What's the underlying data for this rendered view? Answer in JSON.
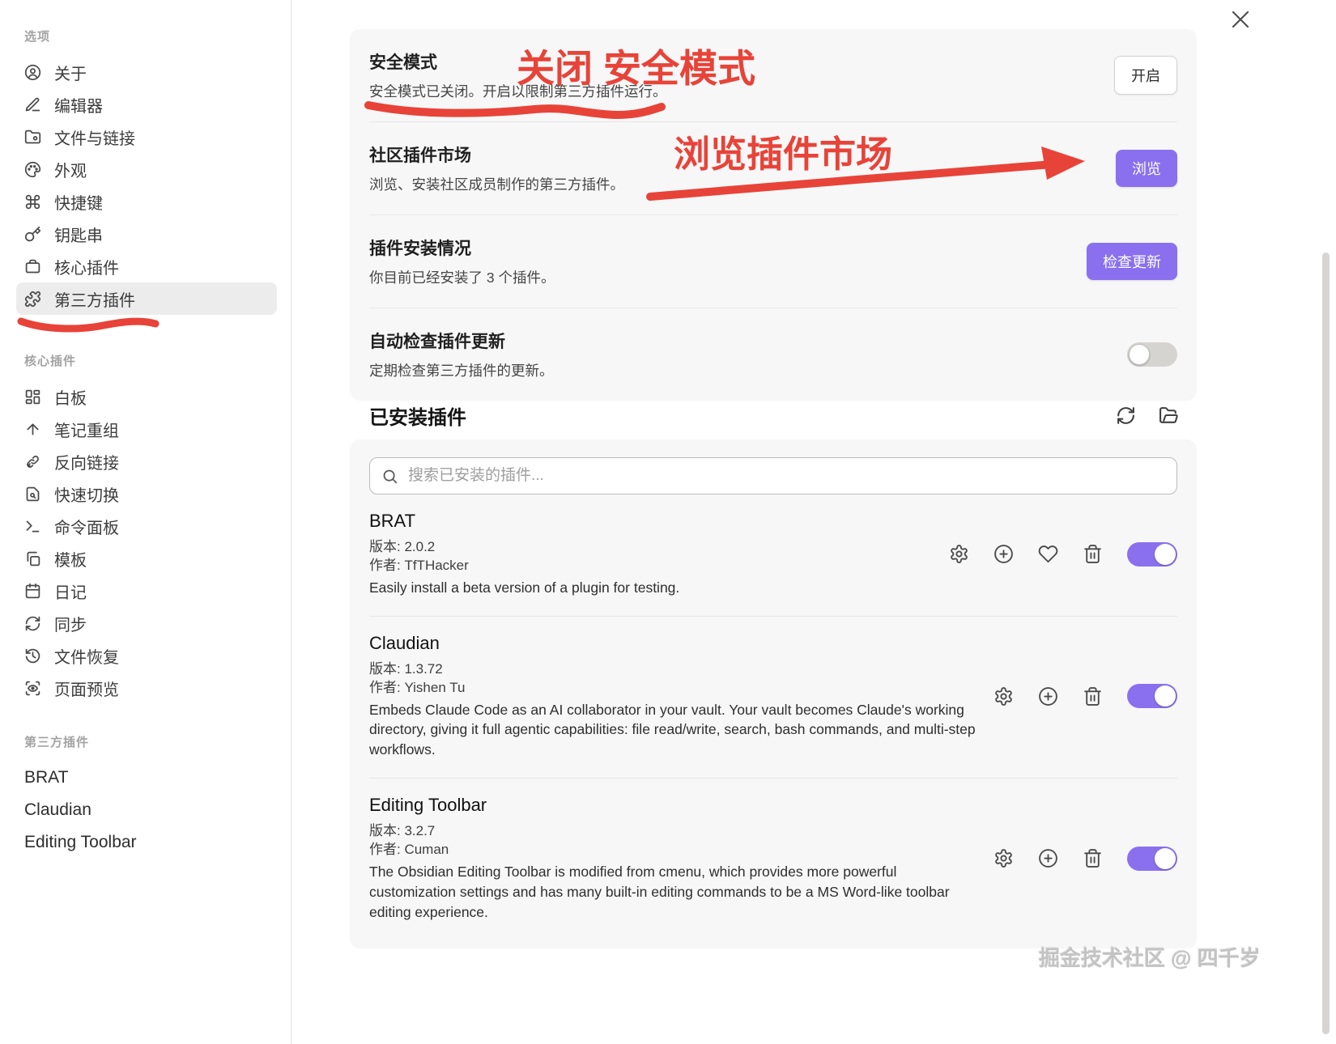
{
  "window": {
    "close_icon": "close"
  },
  "sidebar": {
    "sections": [
      {
        "header": "选项",
        "items": [
          {
            "icon": "user-circle-icon",
            "label": "关于"
          },
          {
            "icon": "pencil-icon",
            "label": "编辑器"
          },
          {
            "icon": "folder-link-icon",
            "label": "文件与链接"
          },
          {
            "icon": "palette-icon",
            "label": "外观"
          },
          {
            "icon": "command-icon",
            "label": "快捷键"
          },
          {
            "icon": "key-icon",
            "label": "钥匙串"
          },
          {
            "icon": "box-icon",
            "label": "核心插件"
          },
          {
            "icon": "puzzle-icon",
            "label": "第三方插件",
            "active": true
          }
        ]
      },
      {
        "header": "核心插件",
        "items": [
          {
            "icon": "dashboard-icon",
            "label": "白板"
          },
          {
            "icon": "arrow-up-icon",
            "label": "笔记重组"
          },
          {
            "icon": "backlink-icon",
            "label": "反向链接"
          },
          {
            "icon": "file-search-icon",
            "label": "快速切换"
          },
          {
            "icon": "terminal-icon",
            "label": "命令面板"
          },
          {
            "icon": "copy-icon",
            "label": "模板"
          },
          {
            "icon": "calendar-icon",
            "label": "日记"
          },
          {
            "icon": "sync-icon",
            "label": "同步"
          },
          {
            "icon": "history-icon",
            "label": "文件恢复"
          },
          {
            "icon": "preview-icon",
            "label": "页面预览"
          }
        ]
      },
      {
        "header": "第三方插件",
        "items": [
          {
            "label": "BRAT"
          },
          {
            "label": "Claudian"
          },
          {
            "label": "Editing Toolbar"
          }
        ]
      }
    ]
  },
  "settings": {
    "rows": [
      {
        "title": "安全模式",
        "desc": "安全模式已关闭。开启以限制第三方插件运行。",
        "button": "开启"
      },
      {
        "title": "社区插件市场",
        "desc": "浏览、安装社区成员制作的第三方插件。",
        "button": "浏览"
      },
      {
        "title": "插件安装情况",
        "desc": "你目前已经安装了 3 个插件。",
        "button": "检查更新"
      },
      {
        "title": "自动检查插件更新",
        "desc": "定期检查第三方插件的更新。",
        "toggle": "off"
      }
    ]
  },
  "installed": {
    "heading": "已安装插件",
    "search_placeholder": "搜索已安装的插件...",
    "plugins": [
      {
        "name": "BRAT",
        "version_line": "版本: 2.0.2",
        "author_line": "作者: TfTHacker",
        "desc": "Easily install a beta version of a plugin for testing.",
        "toggle": "on"
      },
      {
        "name": "Claudian",
        "version_line": "版本: 1.3.72",
        "author_line": "作者: Yishen Tu",
        "desc": "Embeds Claude Code as an AI collaborator in your vault. Your vault becomes Claude's working directory, giving it full agentic capabilities: file read/write, search, bash commands, and multi-step workflows.",
        "toggle": "on"
      },
      {
        "name": "Editing Toolbar",
        "version_line": "版本: 3.2.7",
        "author_line": "作者: Cuman",
        "desc": "The Obsidian Editing Toolbar is modified from cmenu, which provides more powerful customization settings and has many built-in editing commands to be a MS Word-like toolbar editing experience.",
        "toggle": "on"
      }
    ]
  },
  "annotations": {
    "safe_mode_note": "关闭 安全模式",
    "browse_note": "浏览插件市场",
    "color": "#e84338"
  },
  "watermark": "掘金技术社区 @ 四千岁",
  "colors": {
    "accent": "#8a70ee",
    "card_bg": "#f7f7f8",
    "annotation_red": "#e84338"
  }
}
